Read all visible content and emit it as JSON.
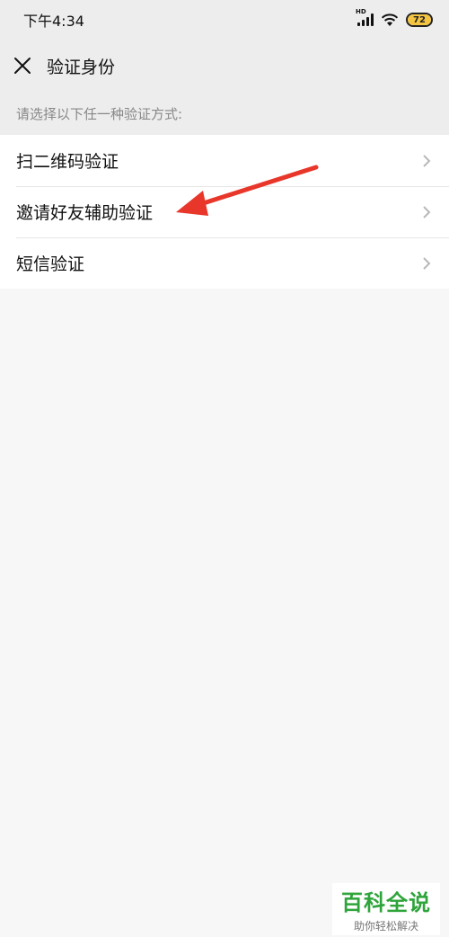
{
  "status_bar": {
    "time": "下午4:34",
    "battery_level": "72",
    "network_label": "HD"
  },
  "header": {
    "title": "验证身份"
  },
  "hint": "请选择以下任一种验证方式:",
  "options": [
    {
      "label": "扫二维码验证"
    },
    {
      "label": "邀请好友辅助验证"
    },
    {
      "label": "短信验证"
    }
  ],
  "watermark": {
    "main": "百科全说",
    "sub": "助你轻松解决"
  },
  "colors": {
    "annotation_arrow": "#e8362a",
    "battery_fill": "#f5c542",
    "watermark_green": "#2ea43a"
  }
}
